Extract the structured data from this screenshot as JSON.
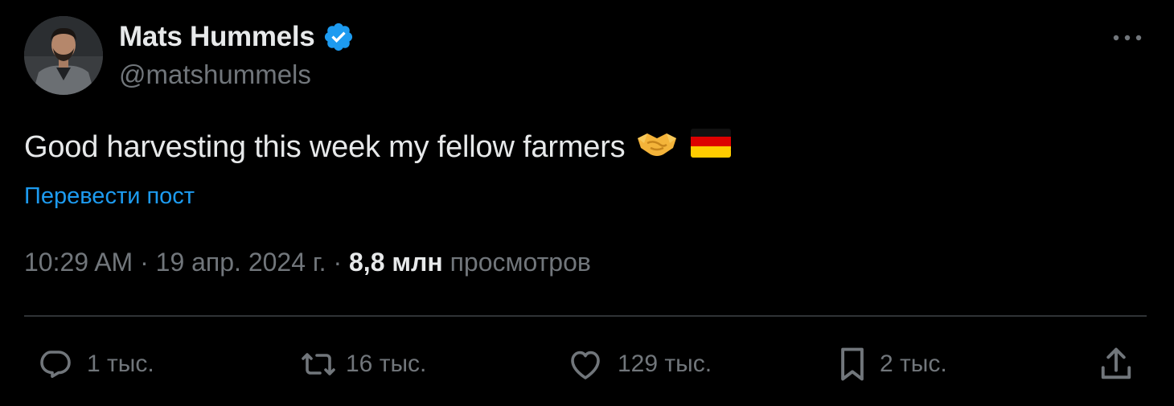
{
  "author": {
    "display_name": "Mats Hummels",
    "handle": "@matshummels",
    "verified_icon": "verified-badge-icon",
    "verified_color": "#1d9bf0"
  },
  "tweet": {
    "text": "Good harvesting this week my fellow farmers",
    "emojis": [
      "handshake-emoji",
      "germany-flag-emoji"
    ],
    "translate_label": "Перевести пост"
  },
  "meta": {
    "time": "10:29 AM",
    "separator": "·",
    "date": "19 апр. 2024 г.",
    "views_count": "8,8 млн",
    "views_label": "просмотров"
  },
  "actions": {
    "replies": "1 тыс.",
    "reposts": "16 тыс.",
    "likes": "129 тыс.",
    "bookmarks": "2 тыс."
  },
  "colors": {
    "background": "#000000",
    "primary_text": "#e7e9ea",
    "secondary_text": "#71767b",
    "link": "#1d9bf0",
    "divider": "#2f3336"
  }
}
